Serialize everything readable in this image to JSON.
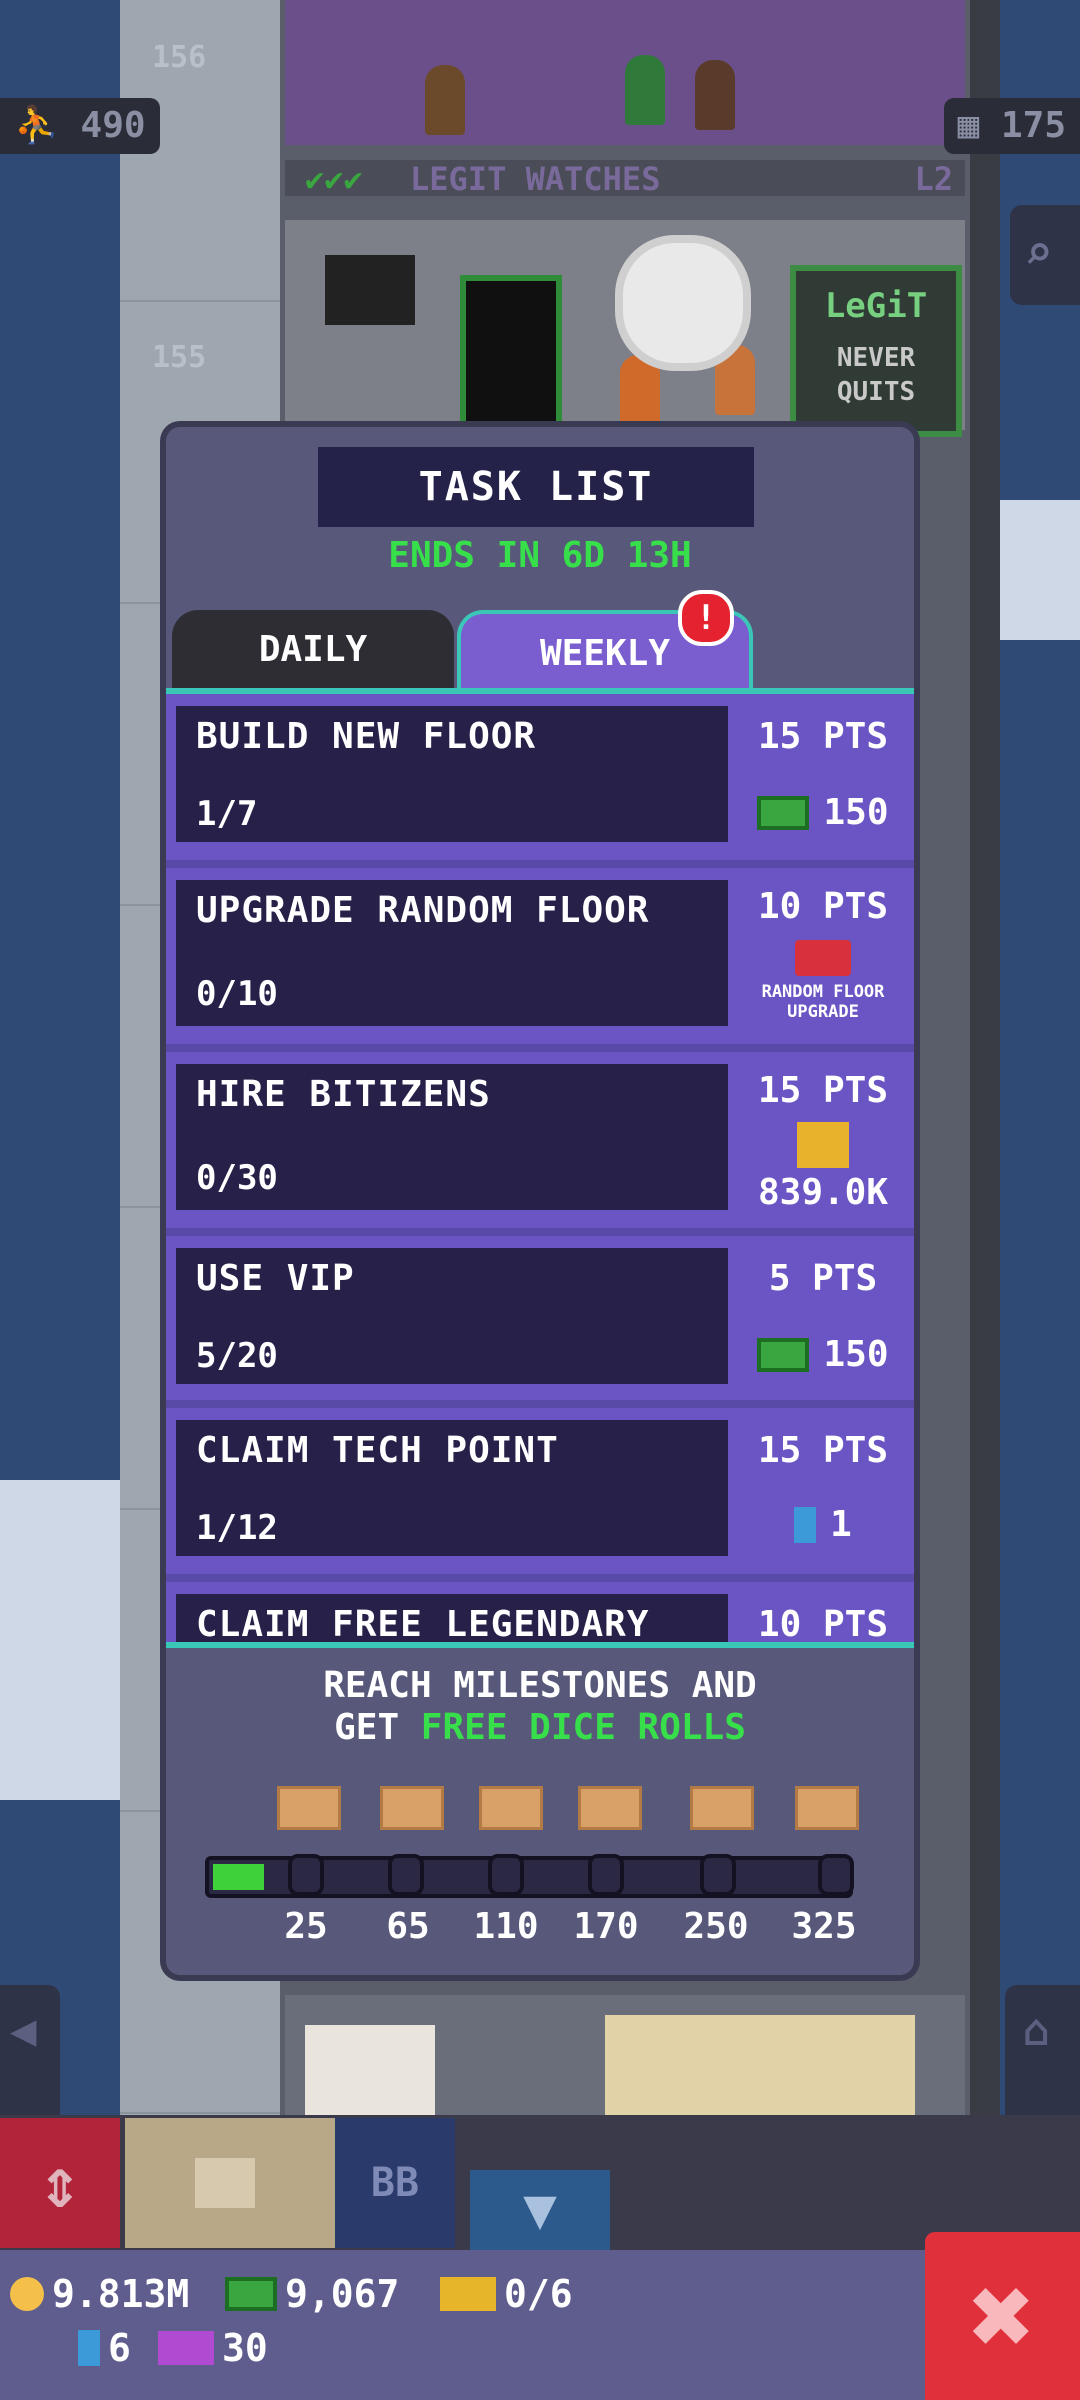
{
  "tower": {
    "floor_numbers": [
      "156",
      "155"
    ],
    "population_count": "490",
    "floors_count": "175",
    "legit_banner": "LEGIT WATCHES",
    "legit_level": "L2",
    "legit_sign_top": "LeGiT",
    "legit_sign_bottom": "NEVER QUITS"
  },
  "task_panel": {
    "title": "TASK LIST",
    "ends_in": "ENDS IN 6D 13H",
    "tabs": [
      {
        "label": "DAILY",
        "selected": false
      },
      {
        "label": "WEEKLY",
        "selected": true
      }
    ],
    "alert_badge": "!",
    "tasks": [
      {
        "name": "BUILD NEW FLOOR",
        "progress": "1/7",
        "points": "15 PTS",
        "reward_icon": "bux-icon",
        "reward_value": "150"
      },
      {
        "name": "UPGRADE RANDOM FLOOR",
        "progress": "0/10",
        "points": "10 PTS",
        "reward_icon": "toolbox-icon",
        "reward_label": "RANDOM FLOOR UPGRADE"
      },
      {
        "name": "HIRE BITIZENS",
        "progress": "0/30",
        "points": "15 PTS",
        "reward_icon": "coins-icon",
        "reward_value": "839.0K"
      },
      {
        "name": "USE VIP",
        "progress": "5/20",
        "points": "5 PTS",
        "reward_icon": "bux-icon",
        "reward_value": "150"
      },
      {
        "name": "CLAIM TECH POINT",
        "progress": "1/12",
        "points": "15 PTS",
        "reward_icon": "tech-icon",
        "reward_value": "1"
      },
      {
        "name": "CLAIM FREE LEGENDARY",
        "progress": "",
        "points": "10 PTS"
      }
    ],
    "milestones": {
      "text_line1": "REACH MILESTONES AND",
      "text_line2_prefix": "GET ",
      "text_line2_highlight": "FREE DICE ROLLS",
      "values": [
        "25",
        "65",
        "110",
        "170",
        "250",
        "325"
      ],
      "current_points": 15,
      "max_points": 325,
      "reward_icon": "dice-icon"
    }
  },
  "toolbar": {
    "bb_label": "BB"
  },
  "currencies": {
    "coins": "9.813M",
    "bux": "9,067",
    "tickets": "0/6",
    "tech_points": "6",
    "dice": "30"
  },
  "colors": {
    "accent_green": "#37e04a",
    "weekly_tab": "#7a5ed0",
    "panel": "#58597a",
    "close_red": "#e0303c"
  }
}
